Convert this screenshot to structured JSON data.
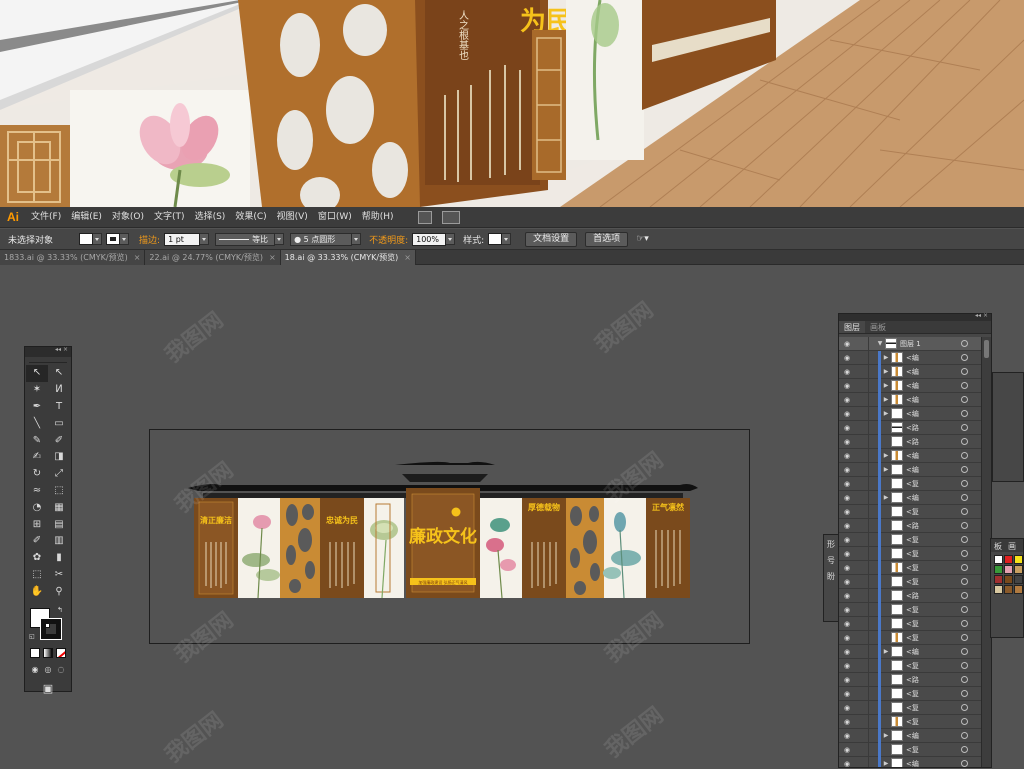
{
  "app": {
    "logo": "Ai"
  },
  "menu": [
    "文件(F)",
    "编辑(E)",
    "对象(O)",
    "文字(T)",
    "选择(S)",
    "效果(C)",
    "视图(V)",
    "窗口(W)",
    "帮助(H)"
  ],
  "control_bar": {
    "selection_status": "未选择对象",
    "stroke_label": "描边:",
    "stroke_weight": "1 pt",
    "stroke_profile": "等比",
    "brush": "5 点圆形",
    "opacity_label": "不透明度:",
    "opacity_value": "100%",
    "style_label": "样式:",
    "doc_setup_button": "文档设置",
    "preferences_button": "首选项"
  },
  "tabs": [
    {
      "label": "1833.ai @ 33.33% (CMYK/预览)",
      "active": false
    },
    {
      "label": "22.ai @ 24.77% (CMYK/预览)",
      "active": false
    },
    {
      "label": "18.ai @ 33.33% (CMYK/预览)",
      "active": true
    }
  ],
  "tools": {
    "icons": [
      "selection-tool-icon",
      "direct-selection-tool-icon",
      "magic-wand-tool-icon",
      "lasso-tool-icon",
      "pen-tool-icon",
      "type-tool-icon",
      "line-tool-icon",
      "rectangle-tool-icon",
      "paintbrush-tool-icon",
      "pencil-tool-icon",
      "blob-brush-tool-icon",
      "eraser-tool-icon",
      "rotate-tool-icon",
      "scale-tool-icon",
      "warp-tool-icon",
      "free-transform-tool-icon",
      "shape-builder-tool-icon",
      "perspective-grid-tool-icon",
      "mesh-tool-icon",
      "gradient-tool-icon",
      "eyedropper-tool-icon",
      "graph-tool-icon",
      "symbol-sprayer-tool-icon",
      "column-graph-tool-icon",
      "artboard-tool-icon",
      "slice-tool-icon",
      "hand-tool-icon",
      "zoom-tool-icon"
    ]
  },
  "artboard": {
    "center_title": "廉政文化",
    "center_slogan": "加强廉政建设  弘扬正气清风",
    "panels": [
      {
        "heading": "清正廉洁"
      },
      {
        "heading": "忠诚为民"
      },
      {
        "heading": "厚德载物"
      },
      {
        "heading": "正气凛然"
      }
    ]
  },
  "preview": {
    "plaque_main": "为民",
    "plaque_sub": "人之根基也"
  },
  "layers_panel": {
    "tabs": [
      "图层",
      "画板"
    ],
    "top_layer": "图层 1",
    "rows": [
      {
        "arrow": true,
        "thumb": "o",
        "name": "<编"
      },
      {
        "arrow": true,
        "thumb": "o",
        "name": "<编"
      },
      {
        "arrow": true,
        "thumb": "o",
        "name": "<编"
      },
      {
        "arrow": true,
        "thumb": "o",
        "name": "<编"
      },
      {
        "arrow": true,
        "thumb": "w",
        "name": "<编"
      },
      {
        "arrow": false,
        "thumb": "b",
        "name": "<路"
      },
      {
        "arrow": false,
        "thumb": "w",
        "name": "<路"
      },
      {
        "arrow": true,
        "thumb": "o",
        "name": "<编"
      },
      {
        "arrow": true,
        "thumb": "w",
        "name": "<编"
      },
      {
        "arrow": false,
        "thumb": "w",
        "name": "<复"
      },
      {
        "arrow": true,
        "thumb": "w",
        "name": "<编"
      },
      {
        "arrow": false,
        "thumb": "w",
        "name": "<复"
      },
      {
        "arrow": false,
        "thumb": "w",
        "name": "<路"
      },
      {
        "arrow": false,
        "thumb": "w",
        "name": "<复"
      },
      {
        "arrow": false,
        "thumb": "w",
        "name": "<复"
      },
      {
        "arrow": false,
        "thumb": "o",
        "name": "<复"
      },
      {
        "arrow": false,
        "thumb": "w",
        "name": "<复"
      },
      {
        "arrow": false,
        "thumb": "w",
        "name": "<路"
      },
      {
        "arrow": false,
        "thumb": "w",
        "name": "<复"
      },
      {
        "arrow": false,
        "thumb": "w",
        "name": "<复"
      },
      {
        "arrow": false,
        "thumb": "o",
        "name": "<复"
      },
      {
        "arrow": true,
        "thumb": "w",
        "name": "<编"
      },
      {
        "arrow": false,
        "thumb": "w",
        "name": "<复"
      },
      {
        "arrow": false,
        "thumb": "w",
        "name": "<路"
      },
      {
        "arrow": false,
        "thumb": "w",
        "name": "<复"
      },
      {
        "arrow": false,
        "thumb": "w",
        "name": "<复"
      },
      {
        "arrow": false,
        "thumb": "o",
        "name": "<复"
      },
      {
        "arrow": true,
        "thumb": "w",
        "name": "<编"
      },
      {
        "arrow": false,
        "thumb": "w",
        "name": "<复"
      },
      {
        "arrow": true,
        "thumb": "w",
        "name": "<编"
      }
    ]
  },
  "side_docks": {
    "left_glyphs": [
      "形",
      "号",
      "盼"
    ],
    "swatch_tabs": [
      "板",
      "画"
    ]
  },
  "watermark": "我图网",
  "colors": {
    "accent": "#ff9a00",
    "wood": "#7a4a1c",
    "panel_gold": "#c98b34",
    "layer_blue": "#4a78c8",
    "title_yellow": "#f6c21a"
  }
}
